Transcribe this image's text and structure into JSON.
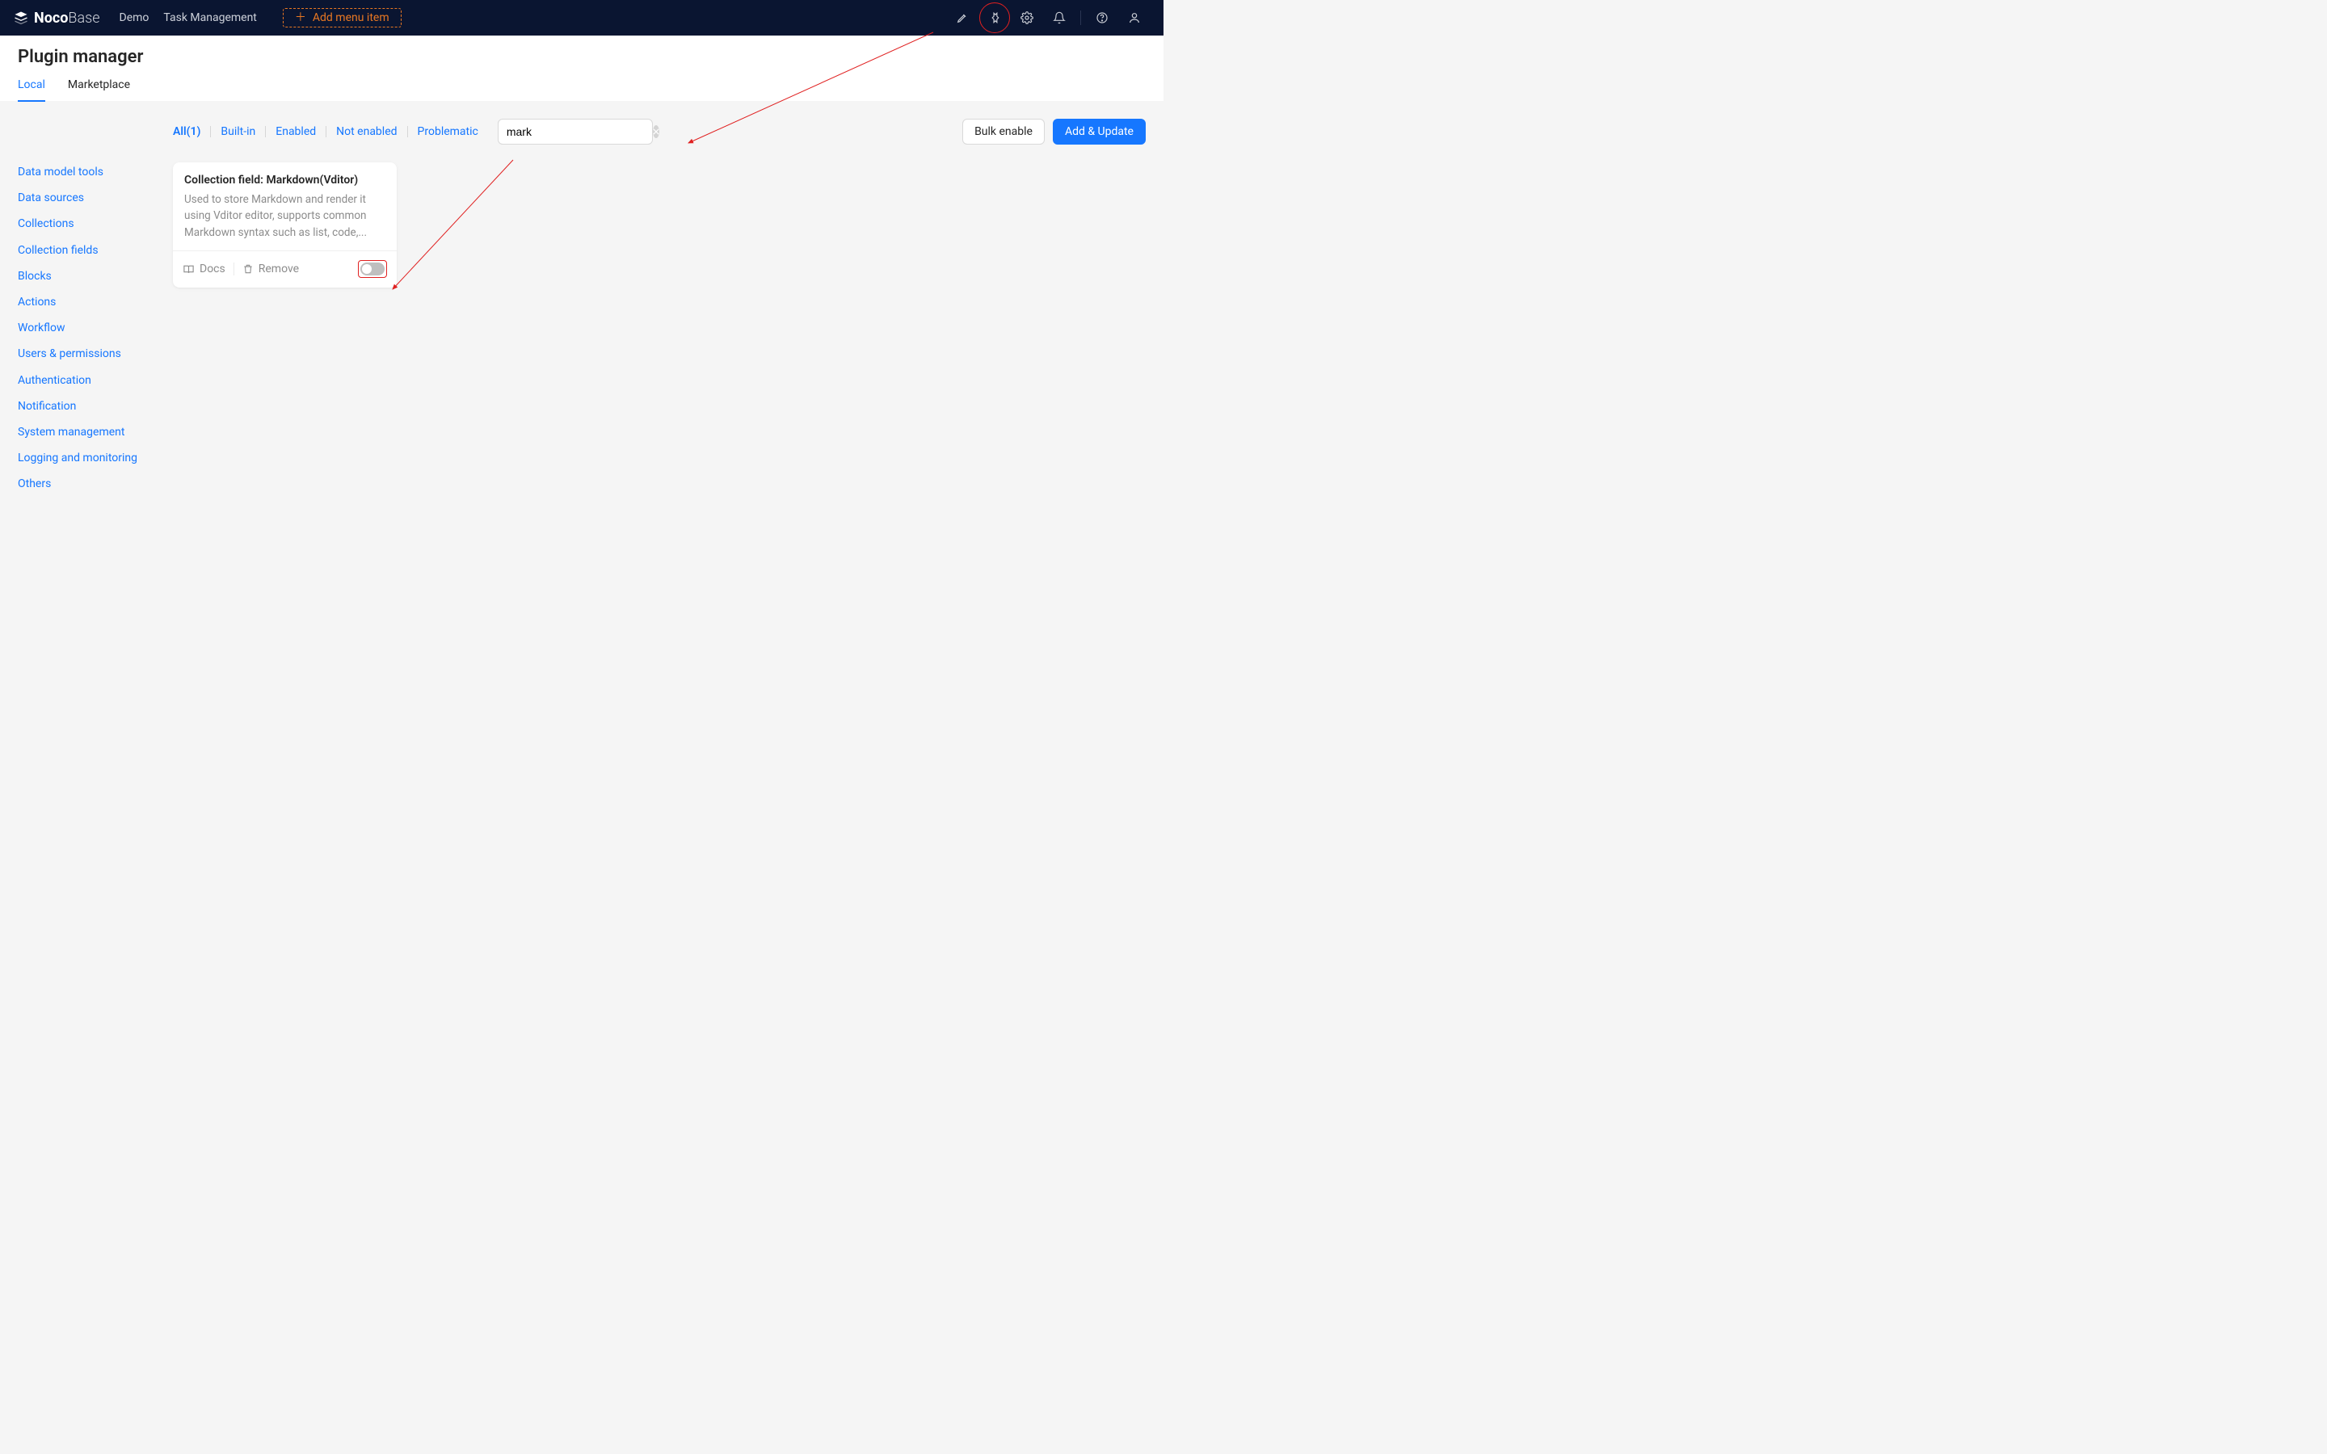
{
  "header": {
    "brand_bold": "Noco",
    "brand_light": "Base",
    "nav": [
      "Demo",
      "Task Management"
    ],
    "add_menu_label": "Add menu item"
  },
  "page": {
    "title": "Plugin manager",
    "tabs": [
      {
        "label": "Local",
        "active": true
      },
      {
        "label": "Marketplace",
        "active": false
      }
    ]
  },
  "sidebar": {
    "categories": [
      "Data model tools",
      "Data sources",
      "Collections",
      "Collection fields",
      "Blocks",
      "Actions",
      "Workflow",
      "Users & permissions",
      "Authentication",
      "Notification",
      "System management",
      "Logging and monitoring",
      "Others"
    ]
  },
  "filters": {
    "items": [
      {
        "label": "All(1)",
        "active": true
      },
      {
        "label": "Built-in",
        "active": false
      },
      {
        "label": "Enabled",
        "active": false
      },
      {
        "label": "Not enabled",
        "active": false
      },
      {
        "label": "Problematic",
        "active": false
      }
    ],
    "search_value": "mark",
    "search_placeholder": "",
    "bulk_enable": "Bulk enable",
    "add_update": "Add & Update"
  },
  "plugin": {
    "title": "Collection field: Markdown(Vditor)",
    "description": "Used to store Markdown and render it using Vditor editor, supports common Markdown syntax such as list, code,...",
    "docs_label": "Docs",
    "remove_label": "Remove",
    "enabled": false
  }
}
